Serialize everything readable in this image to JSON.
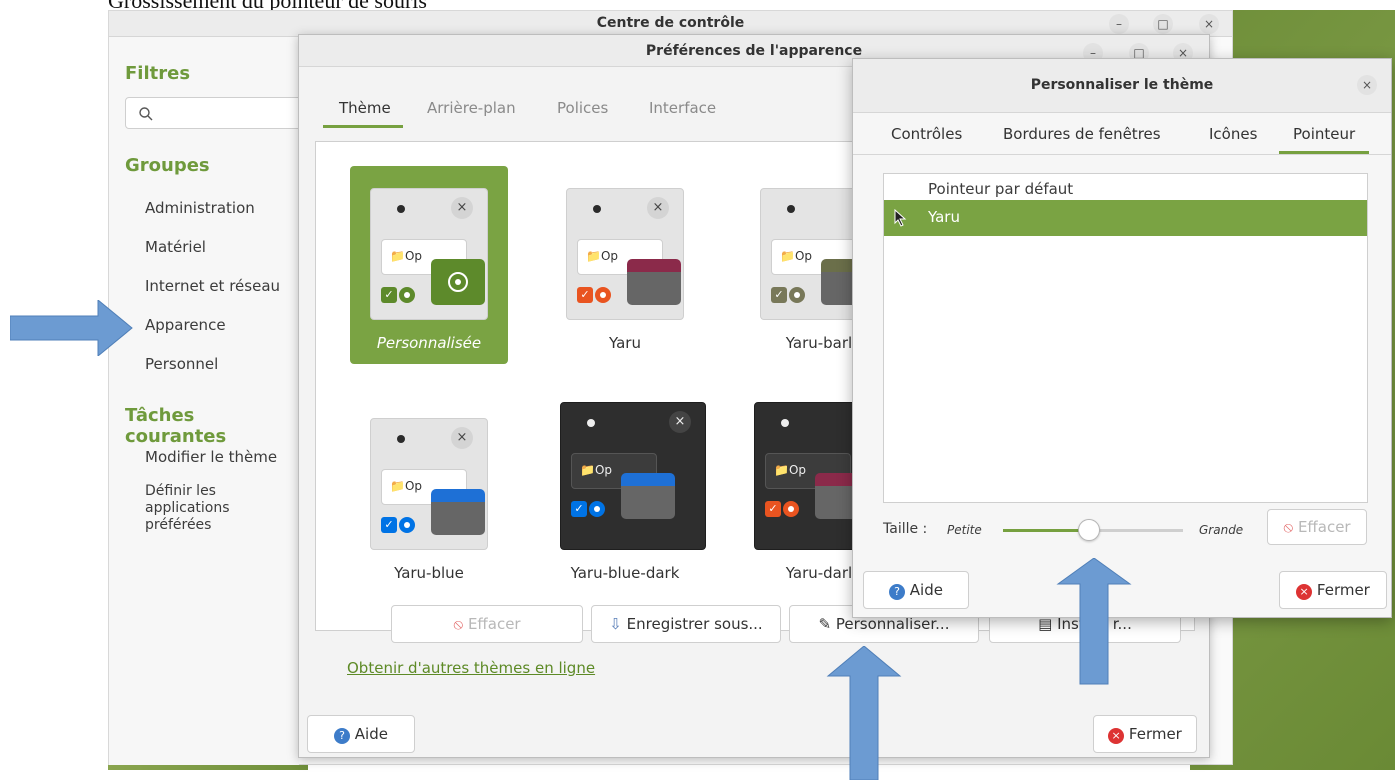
{
  "caption": "Grossissement du pointeur de souris",
  "control_center": {
    "title": "Centre de contrôle",
    "minimize": "–",
    "maximize": "□",
    "close": "×",
    "sidebar": {
      "filters_heading": "Filtres",
      "groups_heading": "Groupes",
      "groups": [
        "Administration",
        "Matériel",
        "Internet et réseau",
        "Apparence",
        "Personnel"
      ],
      "tasks_heading": "Tâches courantes",
      "task_1": "Modifier le thème",
      "task_2_lines": [
        "Définir les",
        "applications",
        "préférées"
      ]
    }
  },
  "appearance": {
    "title": "Préférences de l'apparence",
    "minimize": "–",
    "maximize": "□",
    "close": "×",
    "tabs": [
      "Thème",
      "Arrière-plan",
      "Polices",
      "Interface"
    ],
    "themes": [
      {
        "label": "Personnalisée",
        "selected": true,
        "accent": "#5d8a2b",
        "dark": false
      },
      {
        "label": "Yaru",
        "selected": false,
        "accent": "#e95420",
        "dark": false
      },
      {
        "label": "Yaru-bark",
        "selected": false,
        "accent": "#787859",
        "dark": false
      },
      {
        "label": "Yaru-blue",
        "selected": false,
        "accent": "#0073e5",
        "dark": false
      },
      {
        "label": "Yaru-blue-dark",
        "selected": false,
        "accent": "#0073e5",
        "dark": true
      },
      {
        "label": "Yaru-dark",
        "selected": false,
        "accent": "#e95420",
        "dark": true
      }
    ],
    "visible_labels": [
      "Personnalisée",
      "Yaru",
      "Yaru-barl",
      "Yaru-blue",
      "Yaru-blue-dark",
      "Yaru-darl"
    ],
    "preview_text": "Op",
    "buttons": {
      "clear": "Effacer",
      "save_as": "Enregistrer sous...",
      "customize": "Personnaliser...",
      "install": "Inst",
      "install_tail": "r..."
    },
    "more_themes_link": "Obtenir d'autres thèmes en ligne",
    "help": "Aide",
    "close_button": "Fermer"
  },
  "customize_dialog": {
    "title": "Personnaliser le thème",
    "close": "×",
    "tabs": [
      "Contrôles",
      "Bordures de fenêtres",
      "Icônes",
      "Pointeur"
    ],
    "active_tab": "Pointeur",
    "pointer_list": [
      {
        "label": "Pointeur par défaut",
        "selected": false
      },
      {
        "label": "Yaru",
        "selected": true
      }
    ],
    "size_label": "Taille :",
    "size_min": "Petite",
    "size_max": "Grande",
    "size_value": 0.48,
    "clear_button": "Effacer",
    "help": "Aide",
    "close_button": "Fermer"
  },
  "colors": {
    "accent_green": "#7aa343",
    "heading_green": "#6f9a3c",
    "arrow_blue": "#6c9bd2"
  }
}
